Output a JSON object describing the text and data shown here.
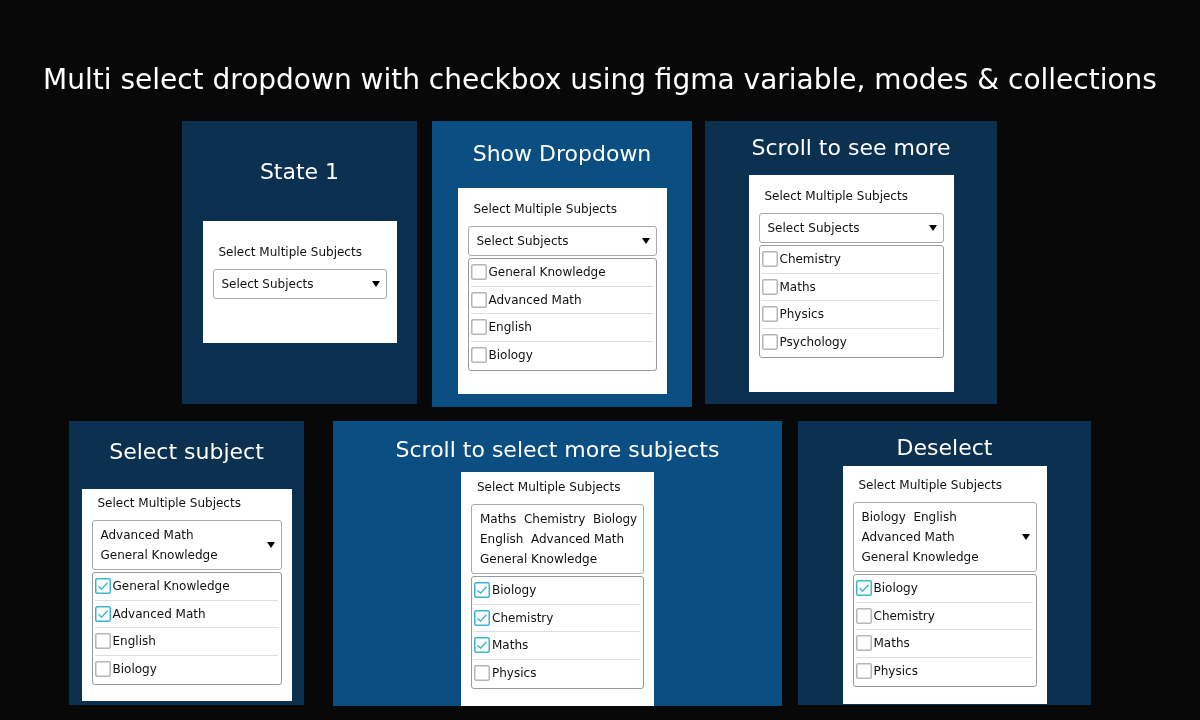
{
  "heading": "Multi select dropdown with checkbox using figma variable, modes & collections",
  "panels": [
    {
      "title": "State 1",
      "color": "#0c3050",
      "field": {
        "label": "Select Multiple Subjects",
        "placeholder": "Select Subjects"
      }
    },
    {
      "title": "Show Dropdown",
      "color": "#0b4f82",
      "field": {
        "label": "Select Multiple Subjects",
        "placeholder": "Select Subjects"
      },
      "options": [
        {
          "label": "General Knowledge",
          "checked": false
        },
        {
          "label": "Advanced Math",
          "checked": false
        },
        {
          "label": "English",
          "checked": false
        },
        {
          "label": "Biology",
          "checked": false
        }
      ]
    },
    {
      "title": "Scroll to see more",
      "color": "#0c3050",
      "field": {
        "label": "Select Multiple Subjects",
        "placeholder": "Select Subjects"
      },
      "options": [
        {
          "label": "Chemistry",
          "checked": false
        },
        {
          "label": "Maths",
          "checked": false
        },
        {
          "label": "Physics",
          "checked": false
        },
        {
          "label": "Psychology",
          "checked": false
        }
      ]
    },
    {
      "title": "Select subject",
      "color": "#0c3050",
      "field": {
        "label": "Select Multiple Subjects",
        "value_lines": [
          "Advanced Math",
          "General Knowledge"
        ]
      },
      "options": [
        {
          "label": "General Knowledge",
          "checked": true
        },
        {
          "label": "Advanced Math",
          "checked": true
        },
        {
          "label": "English",
          "checked": false
        },
        {
          "label": "Biology",
          "checked": false
        }
      ]
    },
    {
      "title": "Scroll to select more subjects",
      "color": "#0b4f82",
      "field": {
        "label": "Select Multiple Subjects",
        "value_lines": [
          "Maths  Chemistry  Biology",
          "English  Advanced Math",
          "General Knowledge"
        ]
      },
      "options": [
        {
          "label": "Biology",
          "checked": true
        },
        {
          "label": "Chemistry",
          "checked": true
        },
        {
          "label": "Maths",
          "checked": true
        },
        {
          "label": "Physics",
          "checked": false
        }
      ]
    },
    {
      "title": "Deselect",
      "color": "#0c3050",
      "field": {
        "label": "Select Multiple Subjects",
        "value_lines": [
          "Biology  English",
          "Advanced Math",
          "General Knowledge"
        ]
      },
      "options": [
        {
          "label": "Biology",
          "checked": true
        },
        {
          "label": "Chemistry",
          "checked": false
        },
        {
          "label": "Maths",
          "checked": false
        },
        {
          "label": "Physics",
          "checked": false
        }
      ]
    }
  ]
}
